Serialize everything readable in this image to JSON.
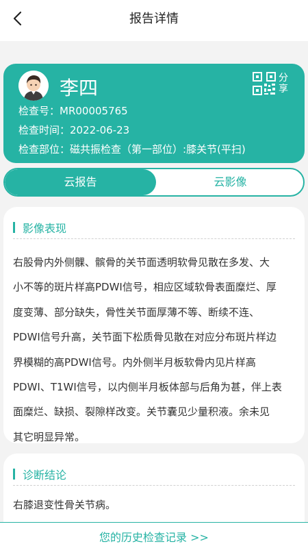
{
  "header": {
    "title": "报告详情"
  },
  "patient": {
    "name": "李四",
    "share_label": "分享",
    "exam_no_label": "检查号：",
    "exam_no": "MR00005765",
    "exam_time_label": "检查时间：",
    "exam_time": "2022-06-23",
    "exam_part_label": "检查部位：",
    "exam_part": "磁共振检查（第一部位）:膝关节(平扫)"
  },
  "tabs": [
    {
      "label": "云报告",
      "active": true
    },
    {
      "label": "云影像",
      "active": false
    }
  ],
  "findings": {
    "title": "影像表现",
    "lines": [
      "右股骨内外侧髁、髌骨的关节面透明软骨见散在多发、大",
      "小不等的斑片样高PDWI信号，相应区域软骨表面糜烂、厚",
      "度变薄、部分缺失，骨性关节面厚薄不等、断续不连、",
      "PDWI信号升高，关节面下松质骨见散在对应分布斑片样边",
      "界模糊的高PDWI信号。内外侧半月板软骨内见片样高",
      "PDWI、T1WI信号，以内侧半月板体部与后角为甚，伴上表",
      "面糜烂、缺损、裂隙样改变。关节囊见少量积液。余未见",
      "其它明显异常。"
    ]
  },
  "conclusion": {
    "title": "诊断结论",
    "text": "右膝退变性骨关节病。"
  },
  "footer": {
    "history_link": "您的历史检查记录 >>"
  },
  "colors": {
    "accent": "#26b3a4",
    "background": "#f3f3f3"
  }
}
